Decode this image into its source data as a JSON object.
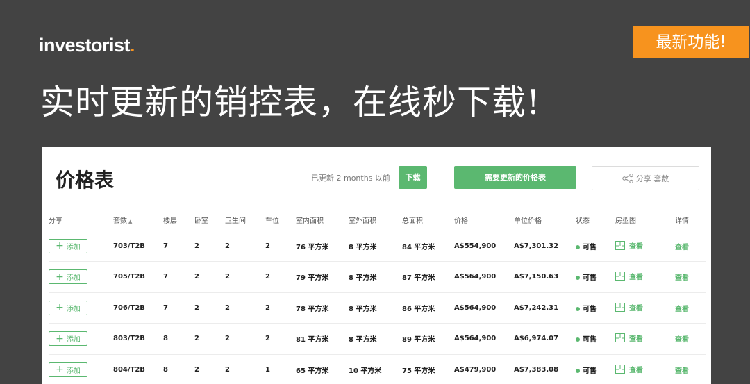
{
  "header": {
    "logo_text": "investorist",
    "logo_dot": ".",
    "badge": "最新功能!",
    "headline": "实时更新的销控表，在线秒下载!"
  },
  "panel": {
    "title": "价格表",
    "updated_text": "已更新 2 months 以前",
    "download_label": "下载",
    "need_update_label": "需要更新的价格表",
    "share_label": "分享 套数"
  },
  "table": {
    "headers": [
      "分享",
      "套数",
      "楼层",
      "卧室",
      "卫生间",
      "车位",
      "室内面积",
      "室外面积",
      "总面积",
      "价格",
      "单位价格",
      "状态",
      "房型图",
      "详情"
    ],
    "sort_indicator": "▲",
    "add_label": "添加",
    "add_plus": "+",
    "rows": [
      {
        "unit": "703/T2B",
        "floor": "7",
        "bed": "2",
        "bath": "2",
        "car": "2",
        "internal": "76 平方米",
        "external": "8 平方米",
        "total": "84 平方米",
        "price": "A$554,900",
        "unit_price": "A$7,301.32",
        "status": "可售",
        "floorplan": "查看",
        "details": "查看"
      },
      {
        "unit": "705/T2B",
        "floor": "7",
        "bed": "2",
        "bath": "2",
        "car": "2",
        "internal": "79 平方米",
        "external": "8 平方米",
        "total": "87 平方米",
        "price": "A$564,900",
        "unit_price": "A$7,150.63",
        "status": "可售",
        "floorplan": "查看",
        "details": "查看"
      },
      {
        "unit": "706/T2B",
        "floor": "7",
        "bed": "2",
        "bath": "2",
        "car": "2",
        "internal": "78 平方米",
        "external": "8 平方米",
        "total": "86 平方米",
        "price": "A$564,900",
        "unit_price": "A$7,242.31",
        "status": "可售",
        "floorplan": "查看",
        "details": "查看"
      },
      {
        "unit": "803/T2B",
        "floor": "8",
        "bed": "2",
        "bath": "2",
        "car": "2",
        "internal": "81 平方米",
        "external": "8 平方米",
        "total": "89 平方米",
        "price": "A$564,900",
        "unit_price": "A$6,974.07",
        "status": "可售",
        "floorplan": "查看",
        "details": "查看"
      },
      {
        "unit": "804/T2B",
        "floor": "8",
        "bed": "2",
        "bath": "2",
        "car": "1",
        "internal": "65 平方米",
        "external": "10 平方米",
        "total": "75 平方米",
        "price": "A$479,900",
        "unit_price": "A$7,383.08",
        "status": "可售",
        "floorplan": "查看",
        "details": "查看"
      }
    ]
  },
  "colors": {
    "background": "#434343",
    "accent_orange": "#f7931e",
    "accent_green": "#5bb870"
  },
  "icons": {
    "share": "share-icon",
    "floorplan": "floorplan-icon",
    "status": "status-dot-icon",
    "sort": "sort-ascending-icon",
    "add": "plus-icon"
  }
}
